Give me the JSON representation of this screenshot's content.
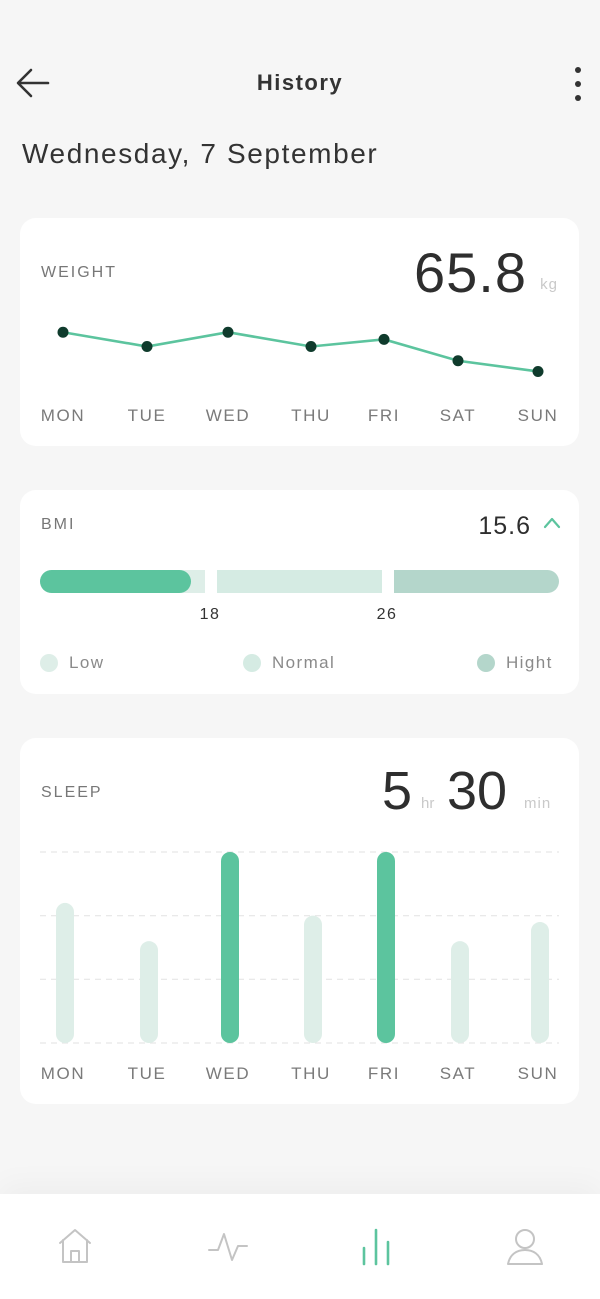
{
  "header": {
    "title": "History",
    "back_icon": "arrow-left-icon",
    "menu_icon": "more-vertical-icon"
  },
  "date": "Wednesday, 7 September",
  "colors": {
    "accent": "#5cc49e",
    "accent_light": "#deeee8",
    "accent_mid": "#b4d6cb",
    "point": "#0f3b2c",
    "text": "#2e2e2e",
    "muted": "#7a7a7a"
  },
  "days": [
    "MON",
    "TUE",
    "WED",
    "THU",
    "FRI",
    "SAT",
    "SUN"
  ],
  "weight": {
    "label": "WEIGHT",
    "value": "65.8",
    "unit": "kg",
    "chart_data": {
      "type": "line",
      "categories": [
        "MON",
        "TUE",
        "WED",
        "THU",
        "FRI",
        "SAT",
        "SUN"
      ],
      "values": [
        66.9,
        66.5,
        66.9,
        66.5,
        66.7,
        66.1,
        65.8
      ],
      "ylim": [
        65,
        68
      ]
    }
  },
  "bmi": {
    "label": "BMI",
    "value": "15.6",
    "trend_icon": "chevron-up-icon",
    "ticks": [
      "18",
      "26"
    ],
    "legend": [
      "Low",
      "Normal",
      "Hight"
    ],
    "value_numeric": 15.6
  },
  "sleep": {
    "label": "SLEEP",
    "hours": "5",
    "hours_unit": "hr",
    "minutes": "30",
    "minutes_unit": "min",
    "chart_data": {
      "type": "bar",
      "categories": [
        "MON",
        "TUE",
        "WED",
        "THU",
        "FRI",
        "SAT",
        "SUN"
      ],
      "values": [
        2.2,
        1.6,
        3.0,
        2.0,
        3.0,
        1.6,
        1.9
      ],
      "highlighted": [
        "WED",
        "FRI"
      ],
      "ylim": [
        0,
        3
      ],
      "grid": true
    }
  },
  "nav": {
    "items": [
      {
        "icon": "home-icon",
        "active": false
      },
      {
        "icon": "activity-icon",
        "active": false
      },
      {
        "icon": "stats-icon",
        "active": true
      },
      {
        "icon": "profile-icon",
        "active": false
      }
    ]
  }
}
